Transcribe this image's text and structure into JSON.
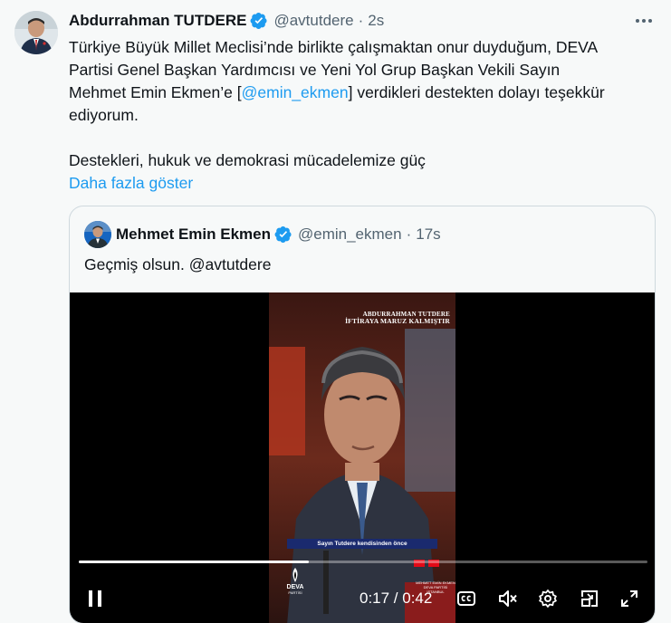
{
  "tweet": {
    "author_name": "Abdurrahman TUTDERE",
    "author_handle": "@avtutdere",
    "separator": "·",
    "time": "2s",
    "text_line1_a": "Türkiye Büyük Millet Meclisi’nde birlikte çalışmaktan onur duyduğum, DEVA",
    "text_line2": "Partisi Genel Başkan Yardımcısı ve Yeni Yol Grup Başkan Vekili Sayın",
    "text_line3_a": "Mehmet Emin Ekmen’e [",
    "text_line3_mention": "@emin_ekmen",
    "text_line3_b": "] verdikleri destekten dolayı teşekkür",
    "text_line4": "ediyorum.",
    "text_para2": "Destekleri, hukuk ve demokrasi mücadelemize güç",
    "show_more": "Daha fazla göster"
  },
  "quoted": {
    "author_name": "Mehmet Emin Ekmen",
    "author_handle": "@emin_ekmen",
    "separator": "·",
    "time": "17s",
    "text": "Geçmiş olsun. @avtutdere"
  },
  "video": {
    "overlay_title_1": "ABDURRAHMAN TUTDERE",
    "overlay_title_2": "İFTİRAYA MARUZ KALMIŞTIR",
    "subtitle": "Sayın Tutdere kendisinden önce",
    "logo_text": "DEVA",
    "logo_sub": "PARTİSİ",
    "name_plate_1": "MEHMET EMİN EKMEN",
    "name_plate_2": "DEVA PARTİSİ İSTANBUL",
    "time_readout": "0:17 / 0:42",
    "progress_fraction": 0.405
  },
  "icons": {
    "verified": "verified-badge-icon",
    "more": "more-options-icon",
    "pause": "pause-icon",
    "captions": "captions-icon",
    "mute": "volume-muted-icon",
    "settings": "gear-icon",
    "pip": "picture-in-picture-icon",
    "fullscreen": "fullscreen-icon"
  },
  "colors": {
    "link": "#1d9bf0",
    "verified": "#1d9bf0",
    "secondary_text": "#536471",
    "background": "#f7f9f9"
  }
}
